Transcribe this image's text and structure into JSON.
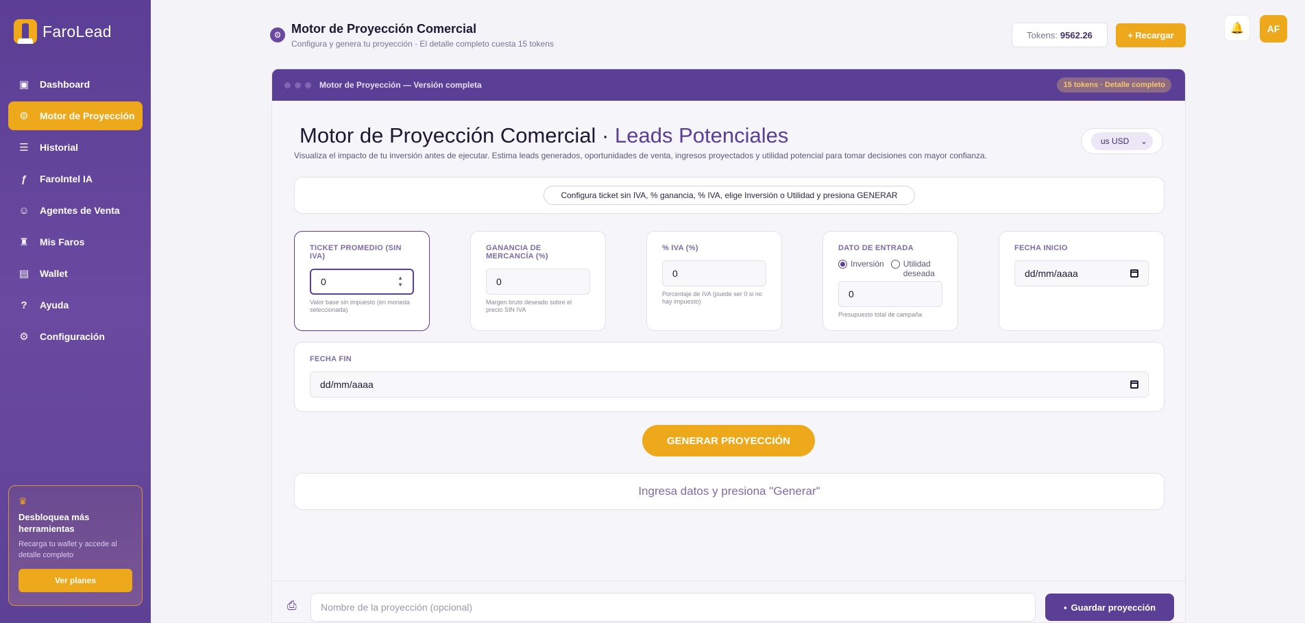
{
  "app": {
    "name": "FaroLead"
  },
  "sidebar": {
    "items": [
      {
        "label": "Dashboard",
        "icon": "dashboard-icon",
        "active": false
      },
      {
        "label": "Motor de Proyección",
        "icon": "projection-engine-icon",
        "active": true
      },
      {
        "label": "Historial",
        "icon": "history-icon",
        "active": false
      },
      {
        "label": "FaroIntel IA",
        "icon": "farointel-icon",
        "active": false
      },
      {
        "label": "Agentes de Venta",
        "icon": "sales-agent-icon",
        "active": false
      },
      {
        "label": "Mis Faros",
        "icon": "lighthouse-icon",
        "active": false
      },
      {
        "label": "Wallet",
        "icon": "wallet-icon",
        "active": false
      },
      {
        "label": "Ayuda",
        "icon": "help-icon",
        "active": false
      },
      {
        "label": "Configuración",
        "icon": "gear-icon",
        "active": false
      }
    ],
    "promo": {
      "title": "Desbloquea más herramientas",
      "text": "Recarga tu wallet y accede al detalle completo",
      "button": "Ver planes"
    }
  },
  "header": {
    "title": "Motor de Proyección Comercial",
    "subtitle": "Configura y genera tu proyección · El detalle completo cuesta 15 tokens",
    "tokens_label": "Tokens:",
    "tokens_value": "9562.26",
    "recharge_label": "+ Recargar",
    "avatar": "AF"
  },
  "panel": {
    "bar_title": "Motor de Proyección — Versión completa",
    "bar_badge": "15 tokens · Detalle completo",
    "title_main": "Motor de Proyección Comercial ·",
    "title_accent": "Leads Potenciales",
    "description": "Visualiza el impacto de tu inversión antes de ejecutar. Estima leads generados, oportunidades de venta, ingresos proyectados y utilidad potencial para tomar decisiones con mayor confianza.",
    "currency": "us USD",
    "hint": "Configura ticket sin IVA, % ganancia, % IVA, elige Inversión o Utilidad y presiona GENERAR",
    "fields": {
      "ticket": {
        "label": "TICKET PROMEDIO (SIN IVA)",
        "value": "0",
        "help": "Valor base sin impuesto (en moneda seleccionada)"
      },
      "ganancia": {
        "label": "GANANCIA DE MERCANCÍA (%)",
        "value": "0",
        "help": "Margen bruto deseado sobre el precio SIN IVA"
      },
      "iva": {
        "label": "% IVA (%)",
        "value": "0",
        "help": "Porcentaje de IVA (puede ser 0 si no hay impuesto)"
      },
      "dato": {
        "label": "DATO DE ENTRADA",
        "option1": "Inversión",
        "option2": "Utilidad deseada",
        "value": "0",
        "help": "Presupuesto total de campaña"
      },
      "fecha_inicio": {
        "label": "FECHA INICIO",
        "value": "dd/mm/aaaa"
      },
      "fecha_fin": {
        "label": "FECHA FIN",
        "value": "dd/mm/aaaa"
      }
    },
    "generate_label": "GENERAR PROYECCIÓN",
    "result_placeholder": "Ingresa datos y presiona \"Generar\"",
    "footer": {
      "name_placeholder": "Nombre de la proyección (opcional)",
      "save_label": "Guardar proyección"
    }
  },
  "colors": {
    "primary": "#5b3e95",
    "accent": "#eda91b"
  }
}
